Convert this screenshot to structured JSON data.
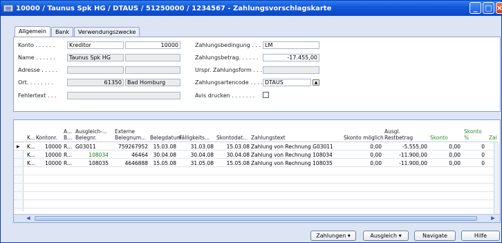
{
  "window": {
    "title": "10000 / Taunus Spk HG / DTAUS / 51250000 / 1234567 - Zahlungsvorschlagskarte"
  },
  "tabs": [
    "Allgemein",
    "Bank",
    "Verwendungszwecke"
  ],
  "form": {
    "konto_label": "Konto . . . . . .",
    "konto_type": "Kreditor",
    "konto_no": "10000",
    "name_label": "Name . . . . . .",
    "name_value": "Taunus Spk HG",
    "adresse_label": "Adresse . . . . .",
    "ort_label": "Ort. . . . . . . .",
    "plz": "61350",
    "ort": "Bad Homburg",
    "fehlertext_label": "Fehlertext . . .",
    "zahlungsbedingung_label": "Zahlungsbedingung . . . .",
    "zahlungsbedingung": "LM",
    "zahlungsbetrag_label": "Zahlungsbetrag. . . . . .",
    "zahlungsbetrag": "-17.455,00",
    "urspr_label": "Urspr. Zahlungsform . . .",
    "zahlungsartencode_label": "Zahlungsartencode . . . .",
    "zahlungsartencode": "DTAUS",
    "avis_label": "Avis drucken . . . . . . .",
    "avis_checked": false
  },
  "grid": {
    "headers": {
      "k": "K...",
      "kontonr": "Kontonr.",
      "a": "A...\nB...",
      "ausgleich": "Ausgleich-...\nBelegnr.",
      "externe": "Externe\nBelegnum...",
      "belegdatum": "Belegdatum",
      "faellig": "Fälligkeits...",
      "skontodat": "Skontodat...",
      "zahlungstext": "Zahlungstext",
      "skonto_moeglich": "Skonto möglich",
      "ausgl_restbetrag": "Ausgl.\nRestbetrag",
      "skonto": "Skonto",
      "skonto_pct": "Skonto\n%",
      "zal": "Zal"
    },
    "rows": [
      {
        "k": "K...",
        "kontonr": "10000",
        "a": "R...",
        "ausgleich": "G03011",
        "externe": "759267952",
        "belegdatum": "15.03.08",
        "faellig": "31.03.08",
        "skontodat": "15.03.08",
        "zahlungstext": "Zahlung von Rechnung G03011",
        "skonto_moeglich": "0,00",
        "restbetrag": "-5.555,00",
        "skonto": "0,00",
        "skonto_pct": "0"
      },
      {
        "k": "K...",
        "kontonr": "10000",
        "a": "R...",
        "ausgleich": "108034",
        "externe": "46464",
        "belegdatum": "30.04.08",
        "faellig": "30.04.08",
        "skontodat": "30.04.08",
        "zahlungstext": "Zahlung von Rechnung 108034",
        "skonto_moeglich": "0,00",
        "restbetrag": "-11.900,00",
        "skonto": "0,00",
        "skonto_pct": "0"
      },
      {
        "k": "K...",
        "kontonr": "10000",
        "a": "R...",
        "ausgleich": "108035",
        "externe": "4646888",
        "belegdatum": "15.05.08",
        "faellig": "31.05.08",
        "skontodat": "15.05.08",
        "zahlungstext": "Zahlung von Rechnung 108035",
        "skonto_moeglich": "0,00",
        "restbetrag": "-11.900,00",
        "skonto": "0,00",
        "skonto_pct": "0"
      }
    ]
  },
  "buttons": {
    "zahlungen": "Zahlungen",
    "ausgleich": "Ausgleich",
    "navigate": "Navigate",
    "hilfe": "Hilfe"
  }
}
